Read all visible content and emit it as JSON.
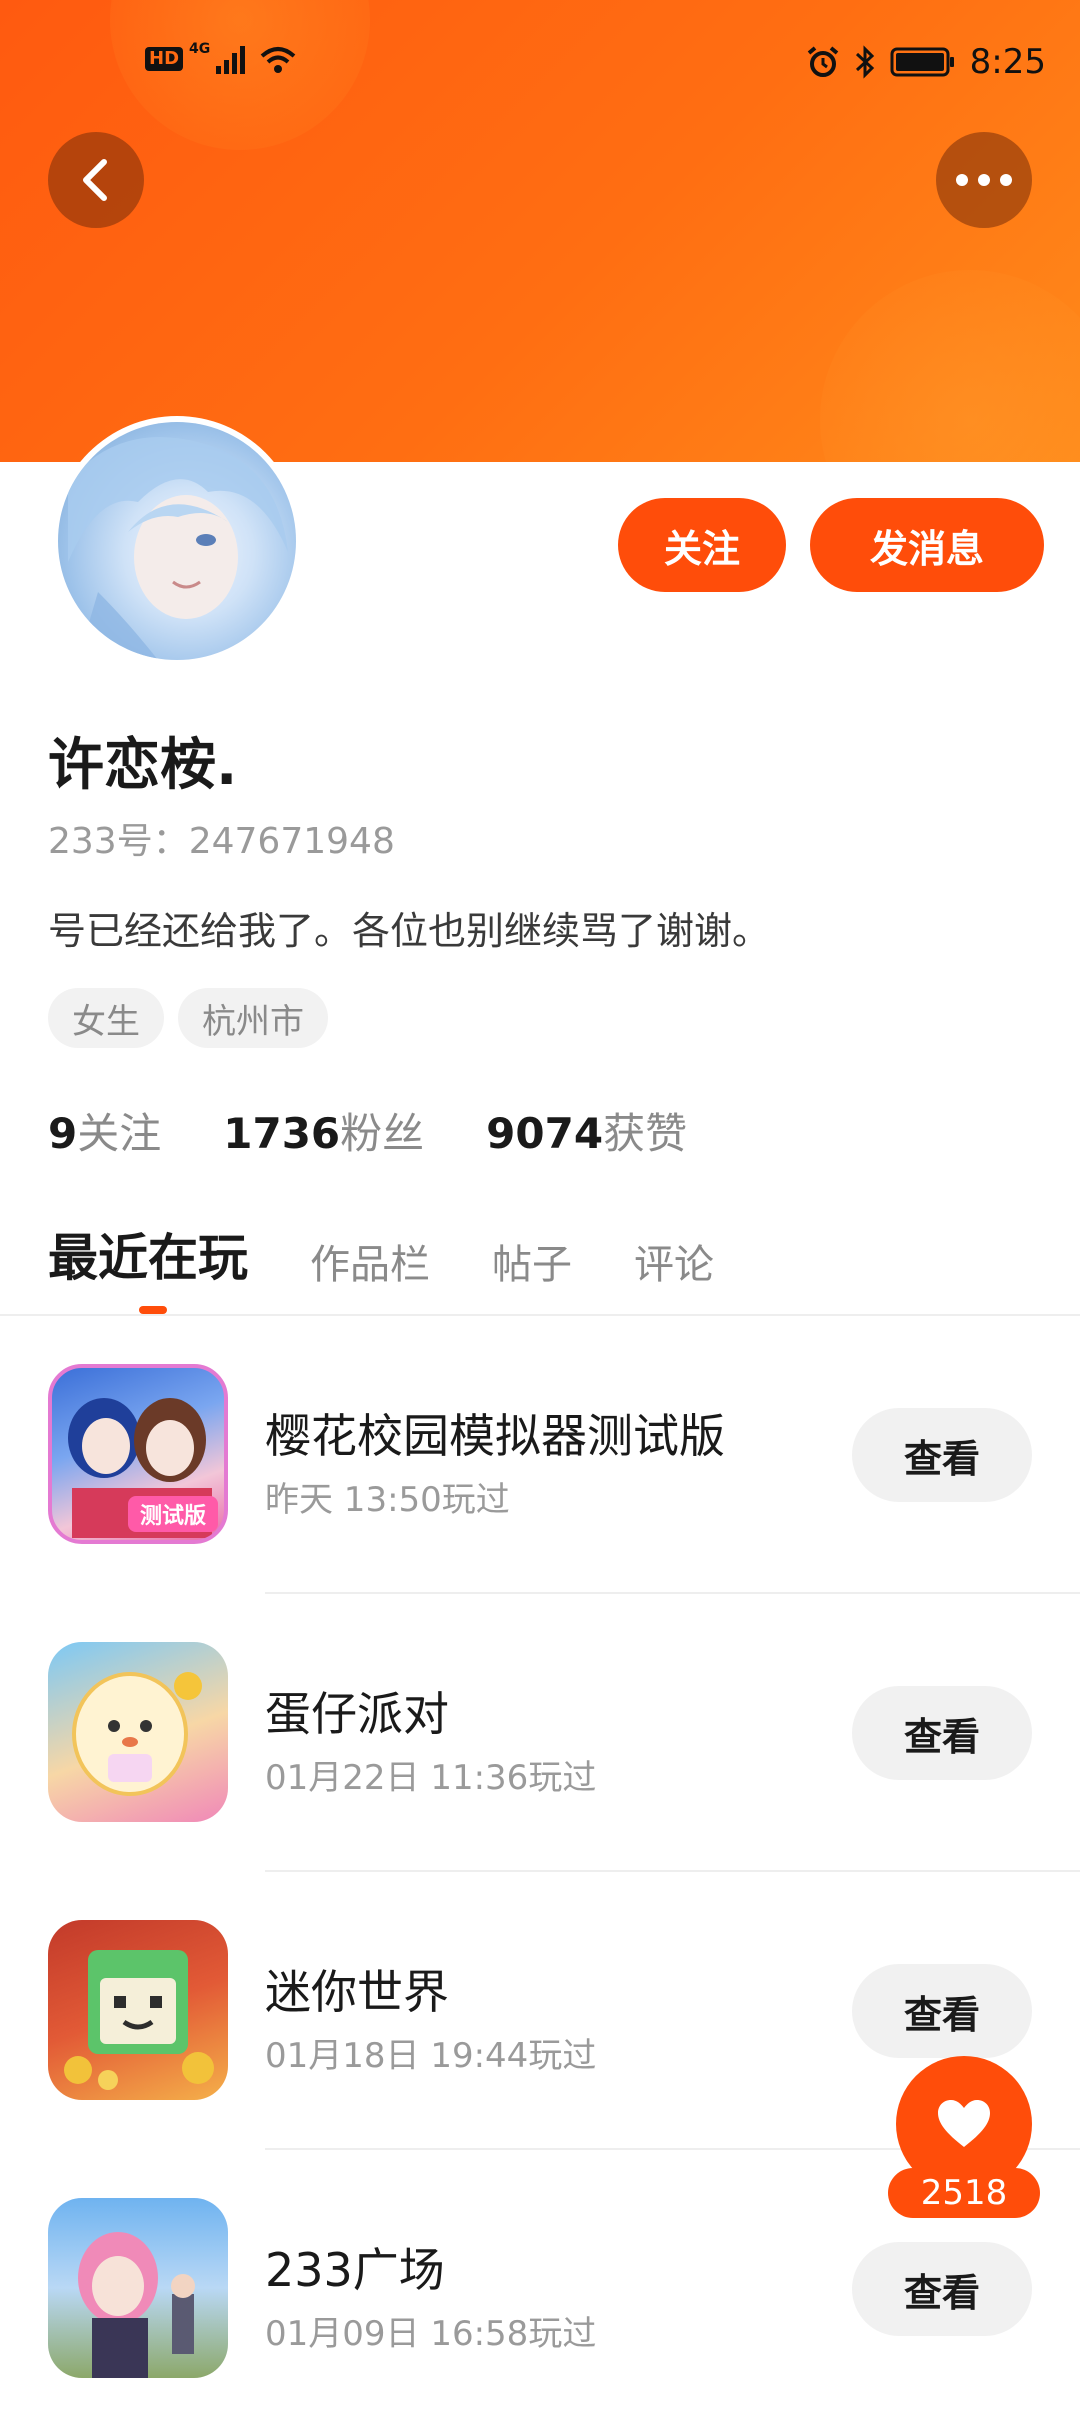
{
  "status_bar": {
    "hd_badge": "HD",
    "network": "4G",
    "time": "8:25",
    "icons": [
      "hd-icon",
      "signal-icon",
      "wifi-icon",
      "alarm-icon",
      "bluetooth-icon",
      "battery-icon"
    ]
  },
  "colors": {
    "accent": "#ff4d0a",
    "header_gradient": [
      "#ff5a10",
      "#ff8a1a"
    ]
  },
  "profile": {
    "name": "许恋桉.",
    "id_text": "233号：247671948",
    "bio": "号已经还给我了。各位也别继续骂了谢谢。",
    "tags": [
      "女生",
      "杭州市"
    ],
    "follow_button": "关注",
    "message_button": "发消息"
  },
  "stats": [
    {
      "num": "9",
      "label": "关注"
    },
    {
      "num": "1736",
      "label": "粉丝"
    },
    {
      "num": "9074",
      "label": "获赞"
    }
  ],
  "tabs": [
    {
      "label": "最近在玩",
      "active": true
    },
    {
      "label": "作品栏",
      "active": false
    },
    {
      "label": "帖子",
      "active": false
    },
    {
      "label": "评论",
      "active": false
    }
  ],
  "games": [
    {
      "title": "樱花校园模拟器测试版",
      "played": "昨天 13:50玩过",
      "button": "查看",
      "icon_text": "测试版"
    },
    {
      "title": "蛋仔派对",
      "played": "01月22日 11:36玩过",
      "button": "查看",
      "icon_text": ""
    },
    {
      "title": "迷你世界",
      "played": "01月18日 19:44玩过",
      "button": "查看",
      "icon_text": ""
    },
    {
      "title": "233广场",
      "played": "01月09日 16:58玩过",
      "button": "查看",
      "icon_text": ""
    }
  ],
  "like": {
    "count": "2518",
    "icon": "heart-icon"
  }
}
